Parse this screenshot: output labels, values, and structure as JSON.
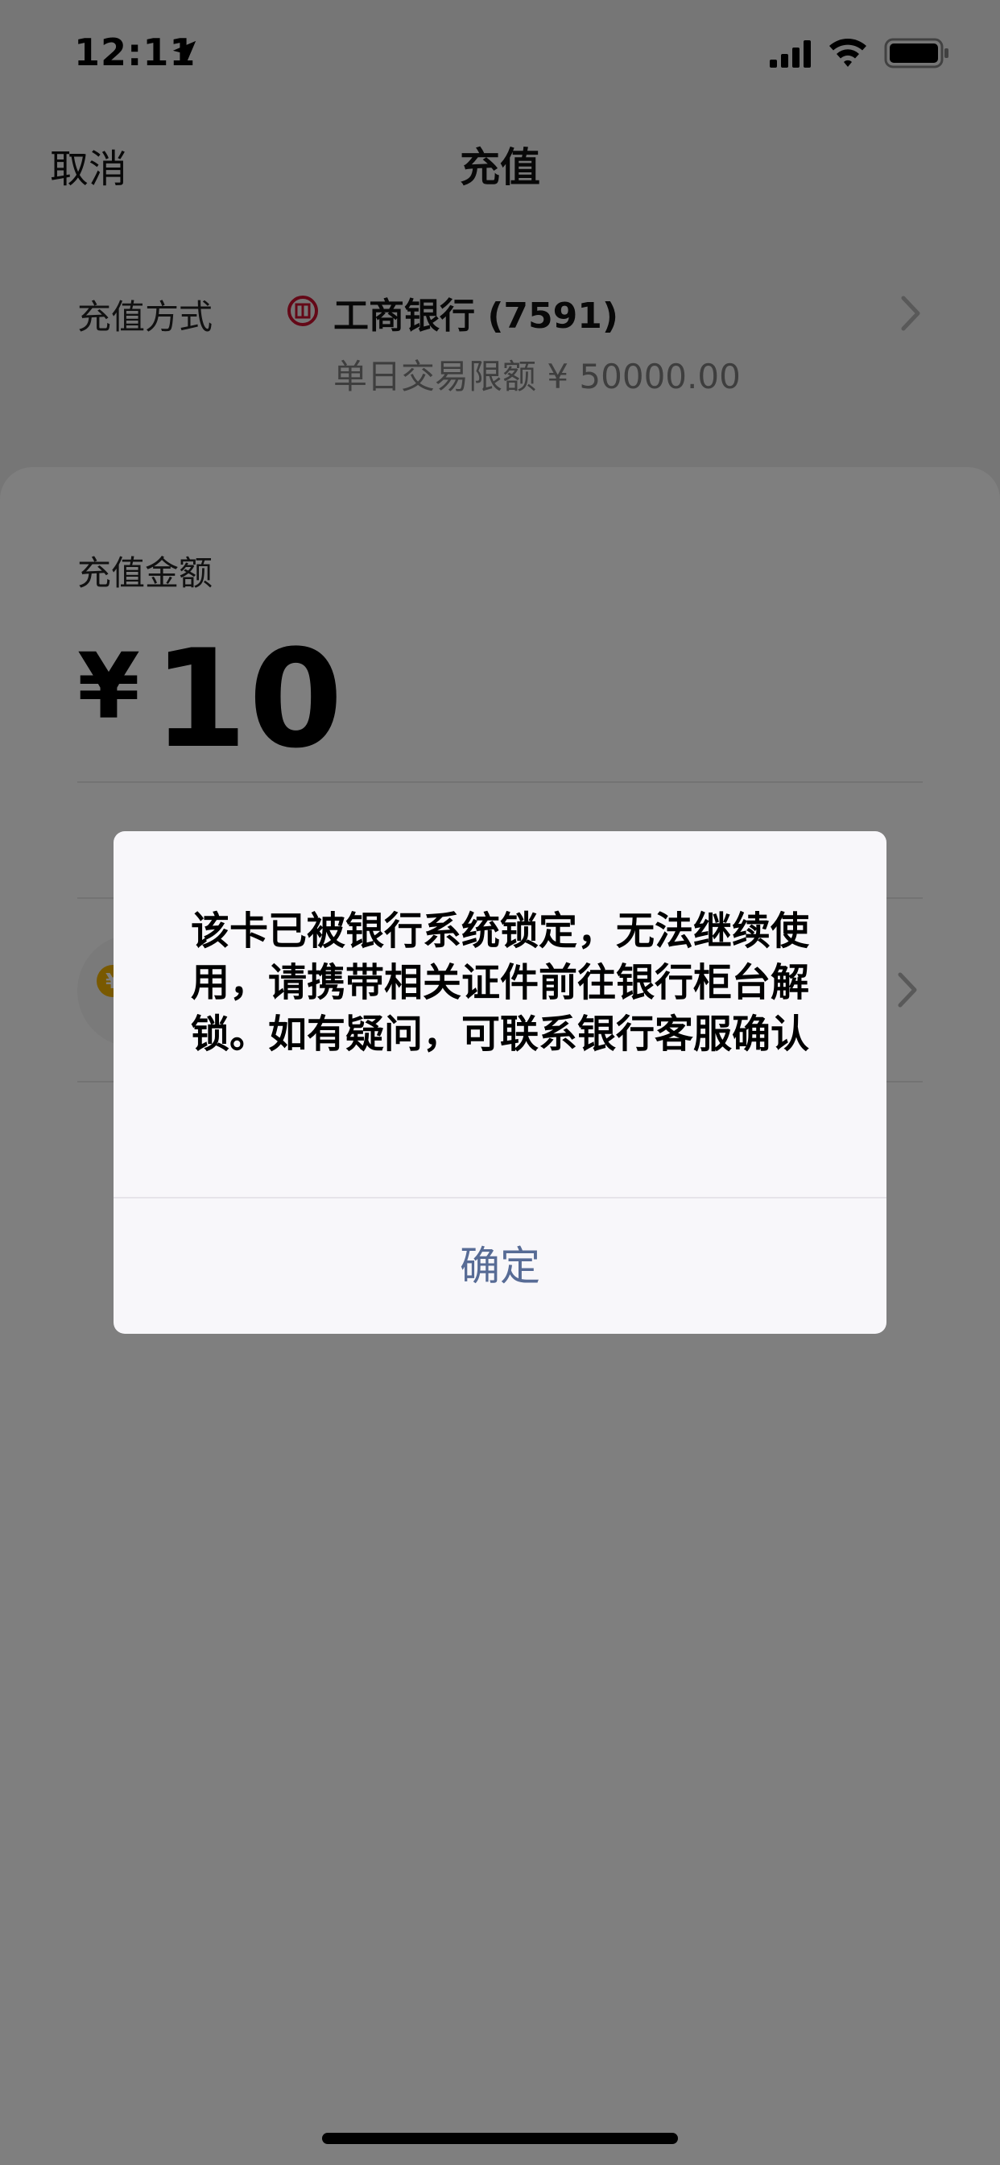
{
  "status_bar": {
    "time": "12:11"
  },
  "nav": {
    "cancel": "取消",
    "title": "充值"
  },
  "method": {
    "label": "充值方式",
    "bank": "工商银行 (7591)",
    "limit": "单日交易限额 ¥ 50000.00"
  },
  "amount": {
    "label": "充值金额",
    "currency": "¥",
    "value": "10"
  },
  "dialog": {
    "message": "该卡已被银行系统锁定，无法继续使用，请携带相关证件前往银行柜台解锁。如有疑问，可联系银行客服确认",
    "confirm": "确定"
  },
  "colors": {
    "accent": "#576b95",
    "bank_red": "#c8102e",
    "coin_yellow": "#f2b200"
  },
  "icons": [
    "location-arrow-icon",
    "cellular-signal-icon",
    "wifi-icon",
    "battery-icon",
    "icbc-logo-icon",
    "chevron-right-icon",
    "coin-icon"
  ]
}
